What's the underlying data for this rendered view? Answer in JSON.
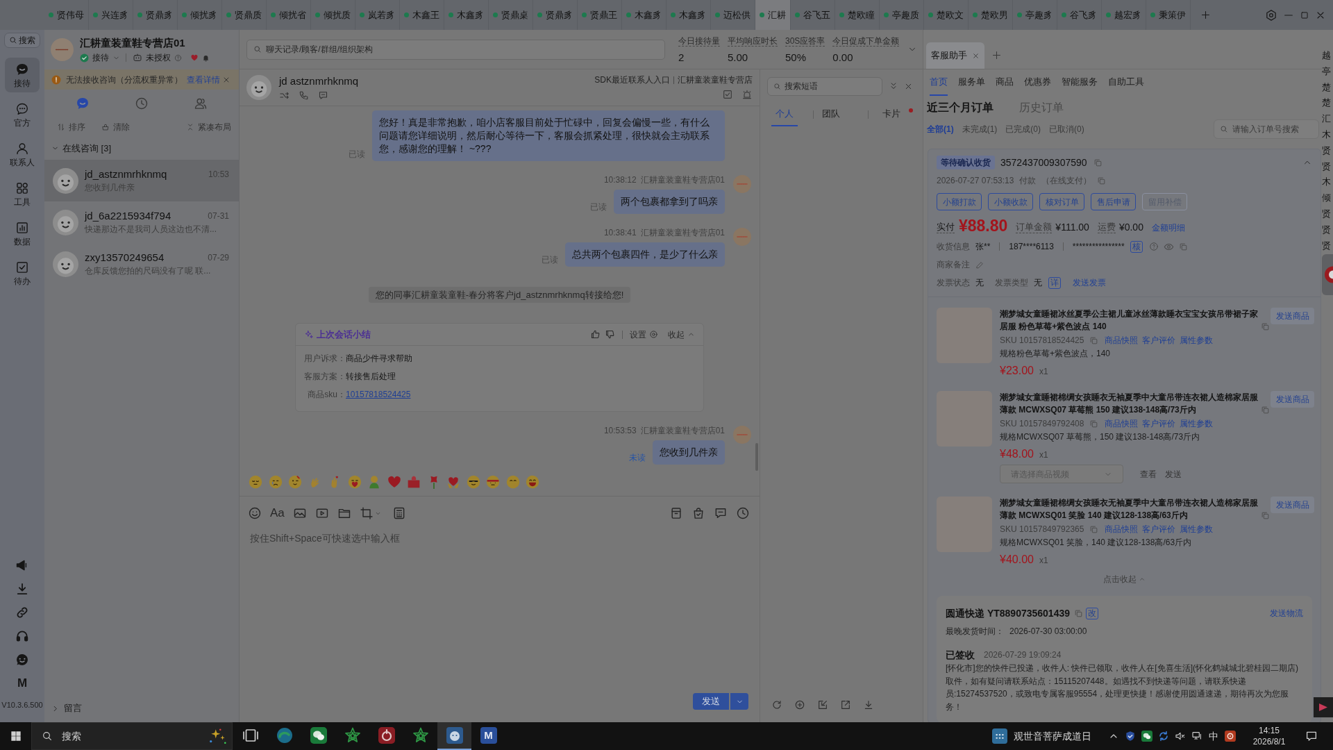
{
  "window_tabs": [
    {
      "label": "贤伟母",
      "selected": false
    },
    {
      "label": "兴连豸",
      "selected": false
    },
    {
      "label": "贤鼎豸",
      "selected": false
    },
    {
      "label": "倾扰豸",
      "selected": false
    },
    {
      "label": "贤鼎质",
      "selected": false
    },
    {
      "label": "倾扰省",
      "selected": false
    },
    {
      "label": "倾扰质",
      "selected": false
    },
    {
      "label": "岚若豸",
      "selected": false
    },
    {
      "label": "木鑫王",
      "selected": false
    },
    {
      "label": "木鑫豸",
      "selected": false
    },
    {
      "label": "贤鼎桌",
      "selected": false
    },
    {
      "label": "贤鼎豸",
      "selected": false
    },
    {
      "label": "贤鼎王",
      "selected": false
    },
    {
      "label": "木鑫豸",
      "selected": false
    },
    {
      "label": "木鑫豸",
      "selected": false
    },
    {
      "label": "迈松供",
      "selected": false
    },
    {
      "label": "汇耕",
      "selected": true
    },
    {
      "label": "谷飞五",
      "selected": false
    },
    {
      "label": "楚欧瞳",
      "selected": false
    },
    {
      "label": "亭趣质",
      "selected": false
    },
    {
      "label": "楚欧文",
      "selected": false
    },
    {
      "label": "楚欧男",
      "selected": false
    },
    {
      "label": "亭趣豸",
      "selected": false
    },
    {
      "label": "谷飞豸",
      "selected": false
    },
    {
      "label": "越宏豸",
      "selected": false
    },
    {
      "label": "秉策伊",
      "selected": false
    }
  ],
  "rail": {
    "search": "搜索",
    "items": [
      {
        "kind": "reception",
        "label": "接待",
        "selected": true
      },
      {
        "kind": "official",
        "label": "官方",
        "selected": false
      },
      {
        "kind": "contacts",
        "label": "联系人",
        "selected": false
      },
      {
        "kind": "tools",
        "label": "工具",
        "selected": false
      },
      {
        "kind": "data",
        "label": "数据",
        "selected": false
      },
      {
        "kind": "todo",
        "label": "待办",
        "selected": false
      }
    ],
    "tools": [
      {
        "kind": "megaphone"
      },
      {
        "kind": "download"
      },
      {
        "kind": "link"
      },
      {
        "kind": "headset"
      },
      {
        "kind": "bot"
      },
      {
        "kind": "letter",
        "label": "M"
      }
    ],
    "version": "V10.3.6.500"
  },
  "store": {
    "name": "汇耕童装童鞋专营店01",
    "status": "接待",
    "online": true,
    "auth": "未授权"
  },
  "notice": {
    "text": "无法接收咨询（分流权重异常）",
    "link": "查看详情"
  },
  "list_tabs": [
    {
      "kind": "chat",
      "selected": true
    },
    {
      "kind": "history",
      "selected": false
    },
    {
      "kind": "contacts",
      "selected": false
    }
  ],
  "list_actions": [
    {
      "kind": "sort",
      "label": "排序"
    },
    {
      "kind": "clear",
      "label": "清除"
    },
    {
      "kind": "compact",
      "label": "紧凑布局"
    }
  ],
  "section": {
    "label": "在线咨询 [3]",
    "expanded": true
  },
  "conversations": [
    {
      "name": "jd_astznmrhknmq",
      "time": "10:53",
      "preview": "您收到几件亲",
      "selected": true
    },
    {
      "name": "jd_6a2215934f794",
      "time": "07-31",
      "preview": "快递那边不是我司人员这边也不清...",
      "selected": false
    },
    {
      "name": "zxy13570249654",
      "time": "07-29",
      "preview": "仓库反馈您拍的尺码没有了呢 联...",
      "selected": false
    }
  ],
  "leave_message": {
    "label": "留言",
    "expanded": false
  },
  "search": {
    "placeholder": "聊天记录/顾客/群组/组织架构"
  },
  "stats": [
    {
      "label": "今日接待量",
      "value": "2"
    },
    {
      "label": "平均响应时长",
      "value": "5.00"
    },
    {
      "label": "30S应答率",
      "value": "50%"
    },
    {
      "label": "今日促成下单金额",
      "value": "0.00"
    }
  ],
  "chat": {
    "customer": "jd astznmrhknmq",
    "sdk_link": "SDK最近联系人入口",
    "shop": "汇耕童装童鞋专营店",
    "messages": [
      {
        "kind": "outgoing",
        "text": "您好！真是非常抱歉，咱小店客服目前处于忙碌中，回复会偏慢一些，有什么问题请您详细说明，然后耐心等待一下，客服会抓紧处理，很快就会主动联系您，感谢您的理解！ ~???",
        "status": "已读",
        "read": true
      },
      {
        "kind": "outgoing",
        "time": "10:38:12",
        "sender": "汇耕童装童鞋专营店01",
        "text": "两个包裹都拿到了吗亲",
        "status": "已读",
        "read": true
      },
      {
        "kind": "outgoing",
        "time": "10:38:41",
        "sender": "汇耕童装童鞋专营店01",
        "text": "总共两个包裹四件，是少了什么亲",
        "status": "已读",
        "read": true
      },
      {
        "kind": "notice",
        "text": "您的同事汇耕童装童鞋-春分将客户jd_astznmrhknmq转接给您!"
      },
      {
        "kind": "summary",
        "title": "上次会话小结",
        "settings": "设置",
        "collapse": "收起",
        "rows": [
          {
            "label": "用户诉求：",
            "value": "商品少件寻求帮助",
            "link": false
          },
          {
            "label": "客服方案：",
            "value": "转接售后处理",
            "link": false
          },
          {
            "label": "商品sku：",
            "value": "10157818524425",
            "link": true
          }
        ]
      },
      {
        "kind": "outgoing",
        "time": "10:53:53",
        "sender": "汇耕童装童鞋专营店01",
        "text": "您收到几件亲",
        "status": "未读",
        "read": false
      }
    ]
  },
  "composer": {
    "format": "Aa",
    "placeholder": "按住Shift+Space可快速选中输入框",
    "send": "发送"
  },
  "phrases": {
    "placeholder": "搜索短语",
    "tabs": [
      {
        "label": "个人",
        "selected": true,
        "dot": false
      },
      {
        "label": "团队",
        "selected": false,
        "dot": false
      },
      {
        "label": "卡片",
        "selected": false,
        "dot": true
      }
    ]
  },
  "assistant": {
    "tabs": [
      {
        "label": "客服助手",
        "selected": true
      }
    ],
    "nav": [
      {
        "label": "首页",
        "selected": true
      },
      {
        "label": "服务单",
        "selected": false
      },
      {
        "label": "商品",
        "selected": false
      },
      {
        "label": "优惠券",
        "selected": false
      },
      {
        "label": "智能服务",
        "selected": false
      },
      {
        "label": "自助工具",
        "selected": false
      }
    ],
    "order_tabs": [
      {
        "label": "近三个月订单",
        "selected": true
      },
      {
        "label": "历史订单",
        "selected": false
      }
    ],
    "filters": [
      {
        "label": "全部(1)",
        "selected": true
      },
      {
        "label": "未完成(1)",
        "selected": false
      },
      {
        "label": "已完成(0)",
        "selected": false
      },
      {
        "label": "已取消(0)",
        "selected": false
      }
    ],
    "order_search": {
      "placeholder": "请输入订单号搜索"
    },
    "order": {
      "status": "等待确认收货",
      "number": "3572437009307590",
      "expanded": true,
      "paid_time": "2026-07-27 07:53:13",
      "pay_label": "付款",
      "pay_method": "（在线支付）",
      "buttons": [
        {
          "label": "小额打款",
          "disabled": false
        },
        {
          "label": "小额收款",
          "disabled": false
        },
        {
          "label": "核对订单",
          "disabled": false
        },
        {
          "label": "售后申请",
          "disabled": false
        },
        {
          "label": "留用补偿",
          "disabled": true
        }
      ],
      "amounts": [
        {
          "kind": "paid",
          "label": "实付",
          "value": "¥88.80"
        },
        {
          "kind": "plain",
          "label": "订单金额",
          "value": "¥111.00"
        },
        {
          "kind": "plain",
          "label": "运费",
          "value": "¥0.00"
        }
      ],
      "amount_link": "金额明细",
      "receiver": {
        "label": "收货信息",
        "name": "张**",
        "phone": "187****6113",
        "address": "****************",
        "verify": "核"
      },
      "note_label": "商家备注",
      "invoice": {
        "status_label": "发票状态",
        "status": "无",
        "type_label": "发票类型",
        "type": "无",
        "detail": "详",
        "send": "发送发票"
      },
      "items": [
        {
          "title": "潮梦城女童睡裙冰丝夏季公主裙儿童冰丝薄款睡衣宝宝女孩吊带裙子家居服 粉色草莓+紫色波点 140",
          "sku": "SKU 10157818524425",
          "links": [
            "商品快照",
            "客户评价",
            "属性参数"
          ],
          "spec": "规格粉色草莓+紫色波点，140",
          "price": "¥23.00",
          "qty": "x1",
          "send": "发送商品"
        },
        {
          "title": "潮梦城女童睡裙棉绸女孩睡衣无袖夏季中大童吊带连衣裙人造棉家居服薄款 MCWXSQ07 草莓熊 150 建议138-148高/73斤内",
          "sku": "SKU 10157849792408",
          "links": [
            "商品快照",
            "客户评价",
            "属性参数"
          ],
          "spec": "规格MCWXSQ07 草莓熊，150 建议138-148高/73斤内",
          "price": "¥48.00",
          "qty": "x1",
          "send": "发送商品",
          "video": {
            "placeholder": "请选择商品视频",
            "view": "查看",
            "send": "发送"
          }
        },
        {
          "title": "潮梦城女童睡裙棉绸女孩睡衣无袖夏季中大童吊带连衣裙人造棉家居服薄款 MCWXSQ01 笑脸 140 建议128-138高/63斤内",
          "sku": "SKU 10157849792365",
          "links": [
            "商品快照",
            "客户评价",
            "属性参数"
          ],
          "spec": "规格MCWXSQ01 笑脸，140 建议128-138高/63斤内",
          "price": "¥40.00",
          "qty": "x1",
          "send": "发送商品"
        }
      ],
      "collapse": "点击收起"
    },
    "logistics": {
      "carrier": "圆通快递 YT8890735601439",
      "edit": "改",
      "send": "发送物流",
      "deadline_label": "最晚发货时间：",
      "deadline": "2026-07-30 03:00:00",
      "status": "已签收",
      "status_time": "2026-07-29 19:09:24",
      "detail": "[怀化市]您的快件已投递，收件人: 快件已领取，收件人在[免喜生活](怀化鹤城城北碧桂园二期店)取件，如有疑问请联系站点：15115207448。如遇找不到快递等问题，请联系快递员:15274537520，或致电专属客服95554，处理更快捷！感谢使用圆通速递，期待再次为您服务！"
    }
  },
  "side_strip": [
    "越",
    "亭",
    "楚",
    "楚",
    "汇",
    "木",
    "贤",
    "贤",
    "木",
    "倾",
    "贤",
    "贤",
    "贤"
  ],
  "taskbar": {
    "search": {
      "placeholder": "搜索"
    },
    "apps": [
      {
        "kind": "taskview",
        "selected": false
      },
      {
        "kind": "browser",
        "selected": false
      },
      {
        "kind": "chat",
        "selected": false
      },
      {
        "kind": "star",
        "selected": false
      },
      {
        "kind": "ring",
        "selected": false
      },
      {
        "kind": "star",
        "selected": false
      },
      {
        "kind": "face",
        "selected": true
      },
      {
        "kind": "letter",
        "label": "M",
        "selected": false
      }
    ],
    "event": "观世音菩萨成道日",
    "tray": [
      {
        "kind": "chevron"
      },
      {
        "kind": "shield"
      },
      {
        "kind": "chat"
      },
      {
        "kind": "sync"
      },
      {
        "kind": "mute"
      },
      {
        "kind": "network"
      },
      {
        "kind": "text",
        "label": "中"
      },
      {
        "kind": "ime"
      }
    ],
    "time": "14:15",
    "date": "2026/8/1"
  }
}
